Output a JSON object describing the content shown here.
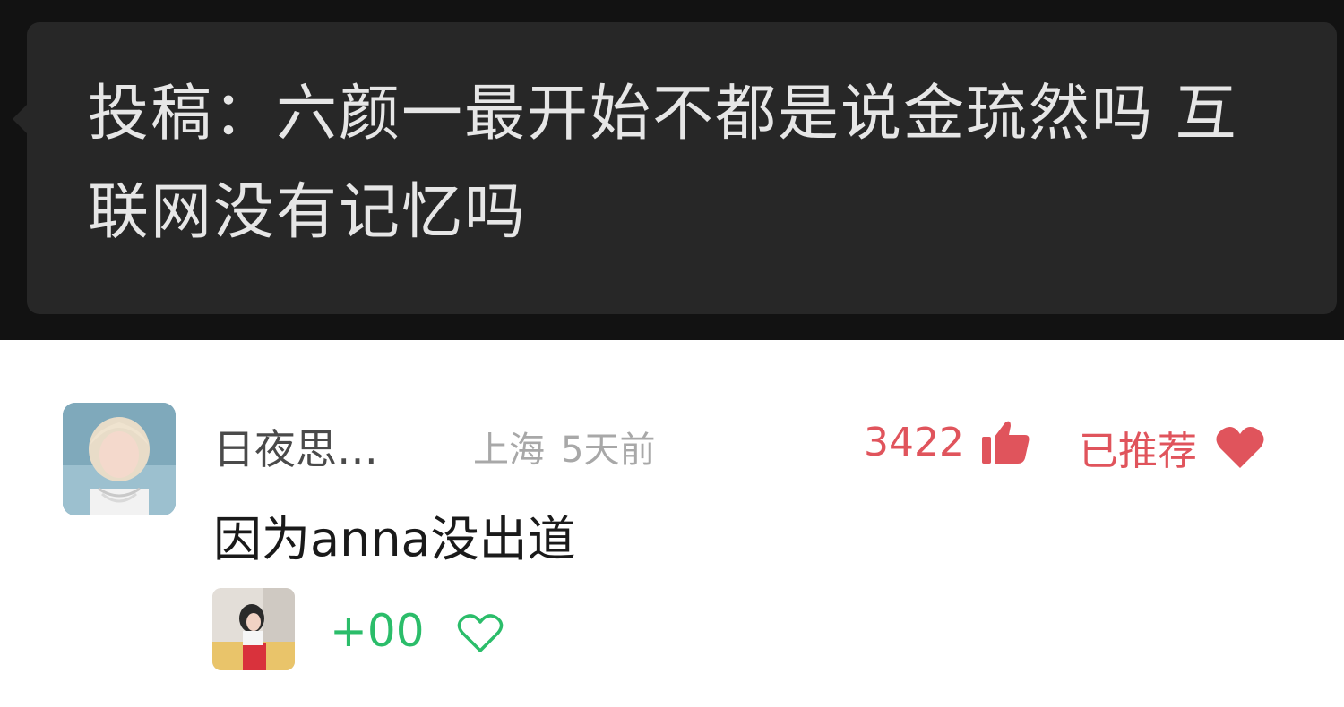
{
  "post": {
    "text": "投稿：六颜一最开始不都是说金琉然吗 互联网没有记忆吗"
  },
  "comment": {
    "username": "日夜思…",
    "location": "上海",
    "time": "5天前",
    "likes": "3422",
    "recommend_label": "已推荐",
    "text": "因为anna没出道",
    "reaction_count": "+00"
  },
  "colors": {
    "like_red": "#e0545c",
    "reaction_green": "#2bbd6a",
    "bubble_bg": "#272727",
    "top_bg": "#121212"
  },
  "icons": {
    "thumb": "thumbs-up-icon",
    "heart_filled": "heart-icon",
    "heart_outline": "heart-outline-icon"
  }
}
